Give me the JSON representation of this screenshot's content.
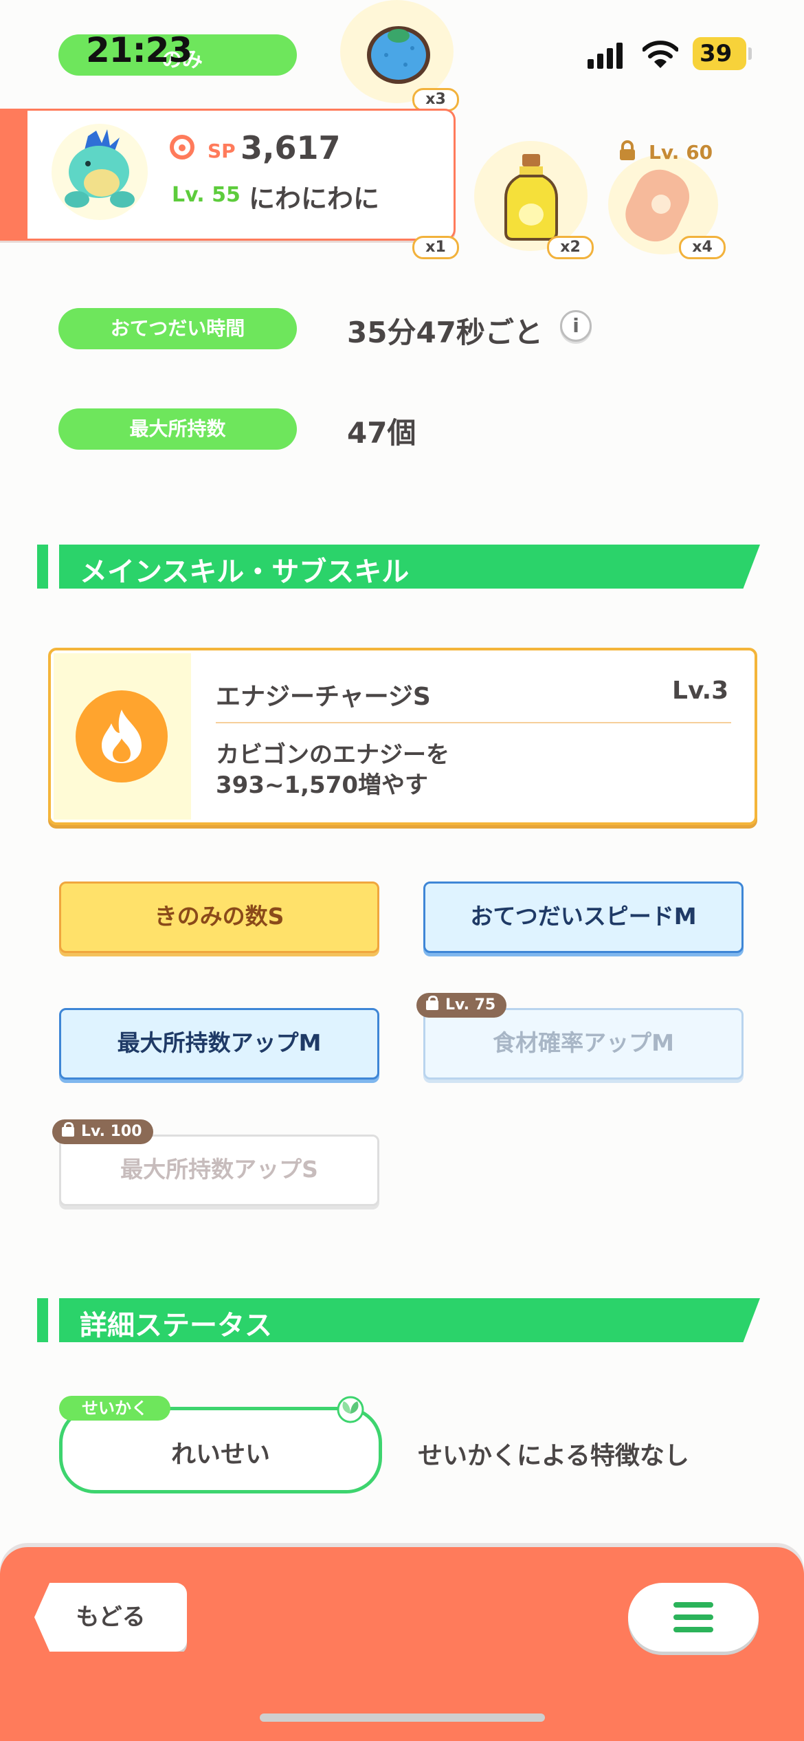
{
  "status_bar": {
    "time": "21:23",
    "battery": "39",
    "overlay_text": "のみ"
  },
  "pokemon": {
    "sp_label": "SP",
    "sp_value": "3,617",
    "level_label": "Lv. 55",
    "name": "にわにわに"
  },
  "items": [
    {
      "icon": "blue-berry-icon",
      "count": "x3"
    },
    {
      "icon": "sprout-icon",
      "count": "x1"
    },
    {
      "icon": "oil-bottle-icon",
      "count": "x2"
    },
    {
      "icon": "sausage-icon",
      "count": "x4",
      "lock_level": "Lv. 60"
    }
  ],
  "info": {
    "help_time_label": "おてつだい時間",
    "help_time_value": "35分47秒ごと",
    "max_carry_label": "最大所持数",
    "max_carry_value": "47個"
  },
  "sections": {
    "skills_title": "メインスキル・サブスキル",
    "details_title": "詳細ステータス"
  },
  "main_skill": {
    "name": "エナジーチャージS",
    "level": "Lv.3",
    "desc_line1": "カビゴンのエナジーを",
    "desc_line2": "393~1,570増やす"
  },
  "sub_skills": [
    {
      "label": "きのみの数S",
      "state": "active-gold"
    },
    {
      "label": "おてつだいスピードM",
      "state": "active-blue"
    },
    {
      "label": "最大所持数アップM",
      "state": "active-blue"
    },
    {
      "label": "食材確率アップM",
      "state": "locked",
      "lock_level": "Lv. 75"
    },
    {
      "label": "最大所持数アップS",
      "state": "locked",
      "lock_level": "Lv. 100"
    }
  ],
  "nature": {
    "tag": "せいかく",
    "name": "れいせい",
    "desc": "せいかくによる特徴なし"
  },
  "bottom_bar": {
    "back_label": "もどる"
  },
  "colors": {
    "accent_green": "#2bd36a",
    "pill_green": "#6ee65c",
    "coral": "#ff7b5b",
    "gold": "#f4b53a"
  }
}
